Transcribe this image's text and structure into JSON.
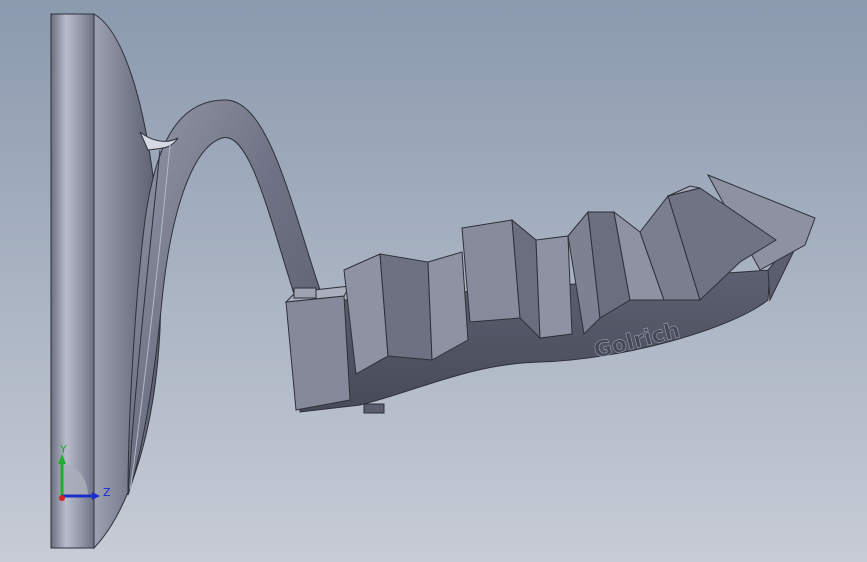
{
  "viewport": {
    "background_top": "#8b9aae",
    "background_bottom": "#c7ccd6",
    "model_color": "#7d8192"
  },
  "model": {
    "engraved_text": "Golrich"
  },
  "triad": {
    "y_label": "Y",
    "z_label": "Z",
    "y_color": "#1fae2e",
    "z_color": "#1b2fc8",
    "x_color": "#d32222"
  }
}
